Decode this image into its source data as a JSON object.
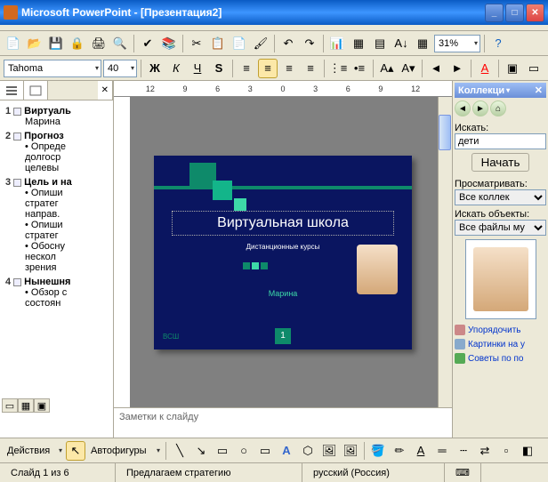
{
  "titlebar": {
    "title": "Microsoft PowerPoint  - [Презентация2]"
  },
  "toolbar1": {
    "zoom": "31%"
  },
  "toolbar2": {
    "font": "Tahoma",
    "size": "40"
  },
  "ruler": [
    "12",
    "9",
    "6",
    "3",
    "0",
    "3",
    "6",
    "9",
    "12"
  ],
  "outline": {
    "items": [
      {
        "num": "1",
        "title": "Виртуаль",
        "subs": [
          "Марина"
        ]
      },
      {
        "num": "2",
        "title": "Прогноз",
        "subs_bul": [
          "Опреде\nдолгоср\nцелевы"
        ]
      },
      {
        "num": "3",
        "title": "Цель и на",
        "subs_bul": [
          "Опиши\nстратег\nнаправ.",
          "Опиши\nстратег",
          "Обосну\nнескол\nзрения"
        ]
      },
      {
        "num": "4",
        "title": "Нынешня",
        "subs_bul": [
          "Обзор с\nсостоян"
        ]
      }
    ]
  },
  "slide": {
    "title": "Виртуальная школа",
    "subtitle": "Дистанционные курсы",
    "author": "Марина",
    "footer": "ВСШ",
    "pagenum": "1"
  },
  "notes": {
    "placeholder": "Заметки к слайду"
  },
  "taskpane": {
    "header": "Коллекци",
    "search_label": "Искать:",
    "search_value": "дети",
    "search_btn": "Начать",
    "browse_label": "Просматривать:",
    "browse_value": "Все коллек",
    "objects_label": "Искать объекты:",
    "objects_value": "Все файлы му",
    "link1": "Упорядочить",
    "link2": "Картинки на у",
    "link3": "Советы по по"
  },
  "bottom": {
    "actions": "Действия",
    "autoshapes": "Автофигуры"
  },
  "statusbar": {
    "slide": "Слайд 1 из 6",
    "design": "Предлагаем стратегию",
    "lang": "русский (Россия)"
  }
}
